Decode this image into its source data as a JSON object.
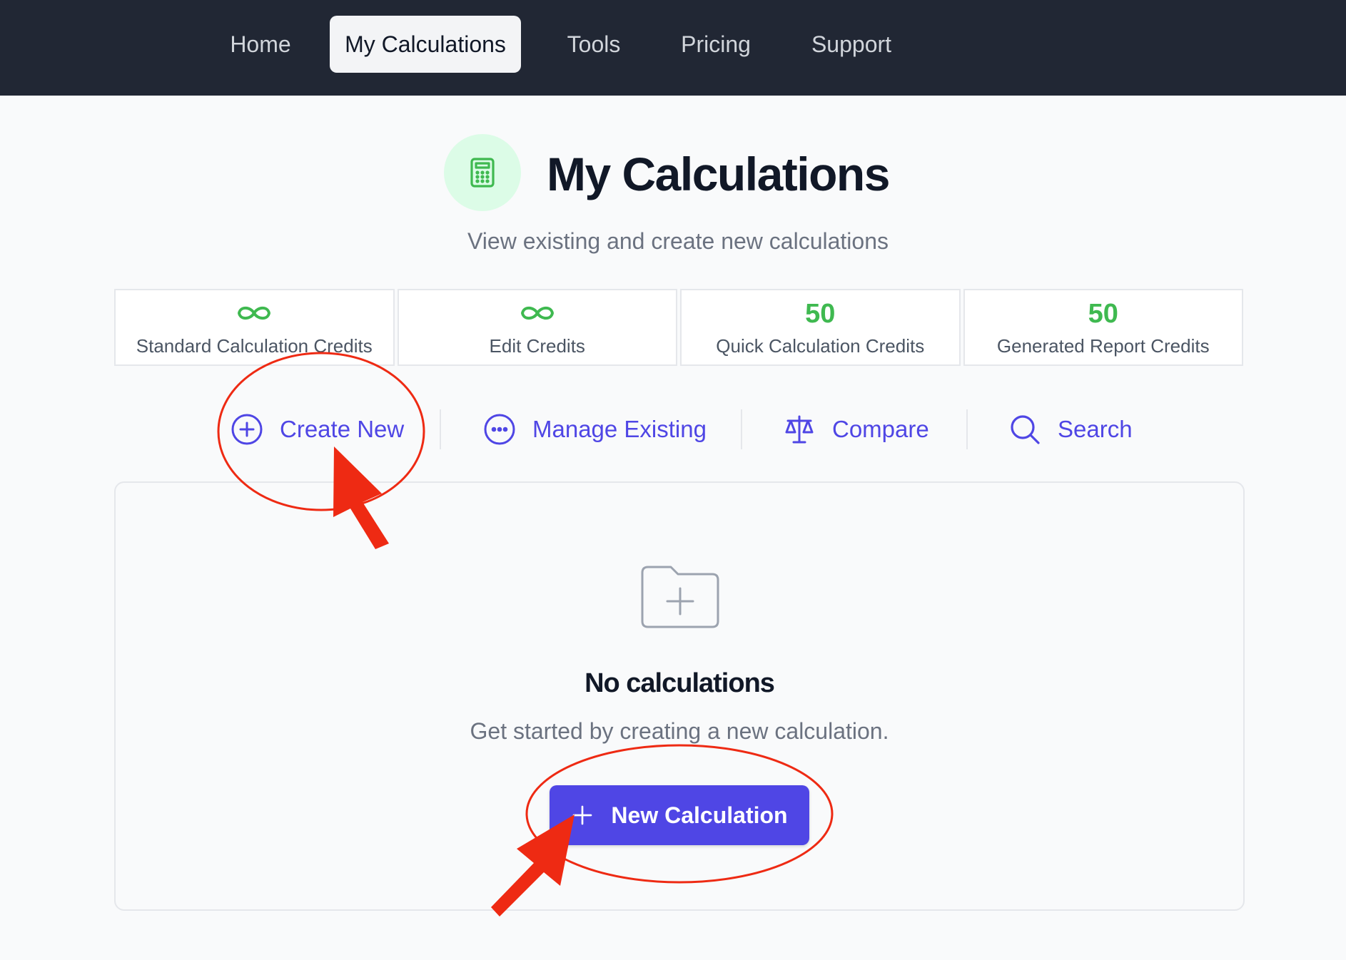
{
  "nav": {
    "items": [
      {
        "label": "Home"
      },
      {
        "label": "My Calculations"
      },
      {
        "label": "Tools"
      },
      {
        "label": "Pricing"
      },
      {
        "label": "Support"
      }
    ],
    "active_index": 1
  },
  "header": {
    "icon": "calculator-icon",
    "title": "My Calculations",
    "subtitle": "View existing and create new calculations"
  },
  "credits": [
    {
      "value": "",
      "icon": "infinity-icon",
      "label": "Standard Calculation Credits"
    },
    {
      "value": "",
      "icon": "infinity-icon",
      "label": "Edit Credits"
    },
    {
      "value": "50",
      "label": "Quick Calculation Credits"
    },
    {
      "value": "50",
      "label": "Generated Report Credits"
    }
  ],
  "actions": [
    {
      "label": "Create New",
      "icon": "plus-circle-icon"
    },
    {
      "label": "Manage Existing",
      "icon": "ellipsis-circle-icon"
    },
    {
      "label": "Compare",
      "icon": "scale-icon"
    },
    {
      "label": "Search",
      "icon": "search-icon"
    }
  ],
  "empty_state": {
    "icon": "folder-plus-icon",
    "title": "No calculations",
    "text": "Get started by creating a new calculation.",
    "button_label": "New Calculation"
  },
  "colors": {
    "nav_bg": "#212734",
    "accent": "#4f46e5",
    "credit_green": "#3fb950",
    "annotation_red": "#ee2a13"
  }
}
